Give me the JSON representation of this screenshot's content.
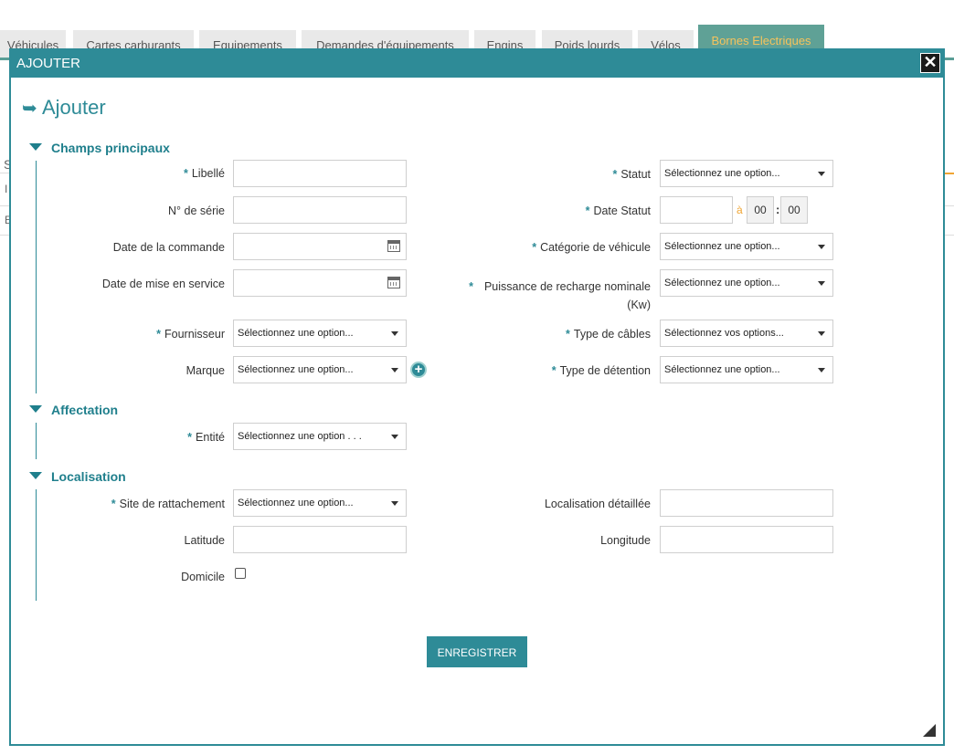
{
  "tabs": [
    "Véhicules",
    "Cartes carburants",
    "Equipements",
    "Demandes d'équipements",
    "Engins",
    "Poids lourds",
    "Vélos",
    "Bornes Electriques"
  ],
  "background": {
    "r1": "S",
    "r2": "I",
    "r3": "E"
  },
  "modal": {
    "header_title": "AJOUTER",
    "close_symbol": "✕",
    "heading_arrow": "➥",
    "heading": "Ajouter",
    "save_label": "ENREGISTRER"
  },
  "sections": {
    "main": "Champs principaux",
    "affect": "Affectation",
    "loc": "Localisation"
  },
  "fields": {
    "libelle": "Libellé",
    "serie": "N° de série",
    "date_commande": "Date de la commande",
    "date_service": "Date de mise en service",
    "fournisseur": "Fournisseur",
    "marque": "Marque",
    "statut": "Statut",
    "date_statut": "Date Statut",
    "categorie": "Catégorie de véhicule",
    "puissance_l1": "Puissance de recharge nominale",
    "puissance_l2": "(Kw)",
    "cables": "Type de câbles",
    "detention": "Type de détention",
    "entite": "Entité",
    "site": "Site de rattachement",
    "latitude": "Latitude",
    "domicile": "Domicile",
    "loc_detail": "Localisation détaillée",
    "longitude": "Longitude"
  },
  "selects": {
    "one": "Sélectionnez une option...",
    "many": "Sélectionnez vos options...",
    "entite": "Sélectionnez une option . . ."
  },
  "time": {
    "sep_a": "à",
    "hour": "00",
    "sep": ":",
    "min": "00"
  },
  "star": "*",
  "plus": "+"
}
